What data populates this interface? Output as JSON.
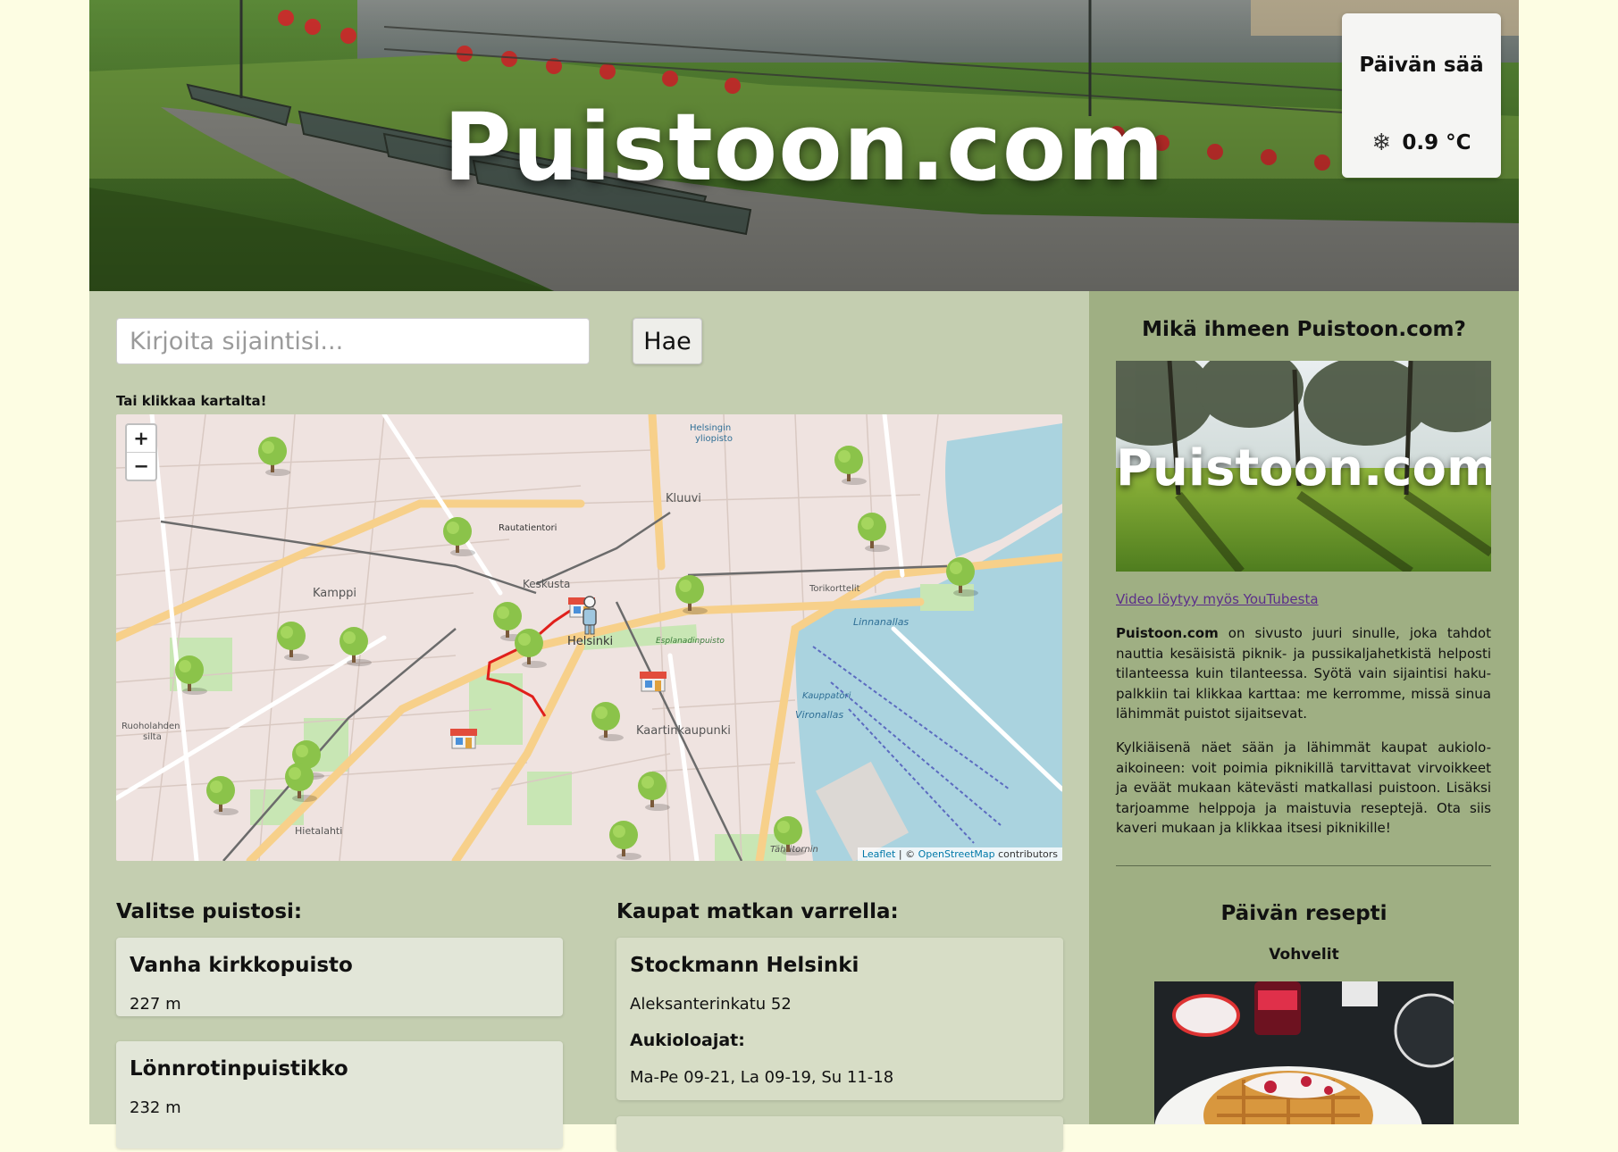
{
  "header": {
    "site_title": "Puistoon.com",
    "weather": {
      "title": "Päivän sää",
      "temperature": "0.9 °C",
      "icon": "snowflake-icon"
    }
  },
  "search": {
    "placeholder": "Kirjoita sijaintisi...",
    "value": "",
    "button_label": "Hae"
  },
  "map": {
    "hint": "Tai klikkaa kartalta!",
    "zoom_in": "+",
    "zoom_out": "−",
    "attribution": {
      "leaflet": "Leaflet",
      "separator": " | © ",
      "osm": "OpenStreetMap",
      "suffix": " contributors"
    },
    "place_labels": [
      "Kamppi",
      "Kluuvi",
      "Keskusta",
      "Helsinki",
      "Kaartinkaupunki",
      "Hietalahti",
      "Ruoholahden silta",
      "Torikorttelit",
      "Linnanallas",
      "Vironallas",
      "Kauppatori",
      "Rautatientori",
      "Helsingin yliopisto",
      "Esplanadinpuisto",
      "Tähtitornin"
    ],
    "markers": {
      "parks": "tree-icon",
      "shops": "shop-icon",
      "user": "person-icon"
    }
  },
  "parks": {
    "heading": "Valitse puistosi:",
    "items": [
      {
        "name": "Vanha kirkkopuisto",
        "distance": "227 m"
      },
      {
        "name": "Lönnrotinpuistikko",
        "distance": "232 m"
      }
    ]
  },
  "shops": {
    "heading": "Kaupat matkan varrella:",
    "items": [
      {
        "name": "Stockmann Helsinki",
        "address": "Aleksanterinkatu 52",
        "hours_label": "Aukioloajat:",
        "hours": "Ma-Pe 09-21, La 09-19, Su 11-18"
      }
    ]
  },
  "sidebar": {
    "about_heading": "Mikä ihmeen Puistoon.com?",
    "video_title": "Puistoon.com",
    "video_link": "Video löytyy myös YouTubesta",
    "about_brand": "Puistoon.com",
    "about_p1_rest": " on sivusto juuri sinulle, joka tahdot nauttia kesäisistä piknik- ja pussikaljahetkistä helposti tilanteessa kuin tilanteessa. Syötä vain sijaintisi haku-palkkiin tai klikkaa karttaa: me kerromme, missä sinua lähimmät puistot sijaitsevat.",
    "about_p2": "Kylkiäisenä näet sään ja lähimmät kaupat aukiolo-aikoineen: voit poimia piknikillä tarvittavat virvoikkeet ja eväät mukaan kätevästi matkallasi puistoon. Lisäksi tarjoamme helppoja ja maistuvia reseptejä. Ota siis kaveri mukaan ja klikkaa itsesi piknikille!",
    "recipe_heading": "Päivän resepti",
    "recipe_name": "Vohvelit"
  },
  "colors": {
    "page_bg": "#fdfde3",
    "main_bg": "#c4ceb0",
    "sidebar_bg": "#9faf83",
    "route": "#e0201c",
    "link": "#5b2e8a"
  }
}
